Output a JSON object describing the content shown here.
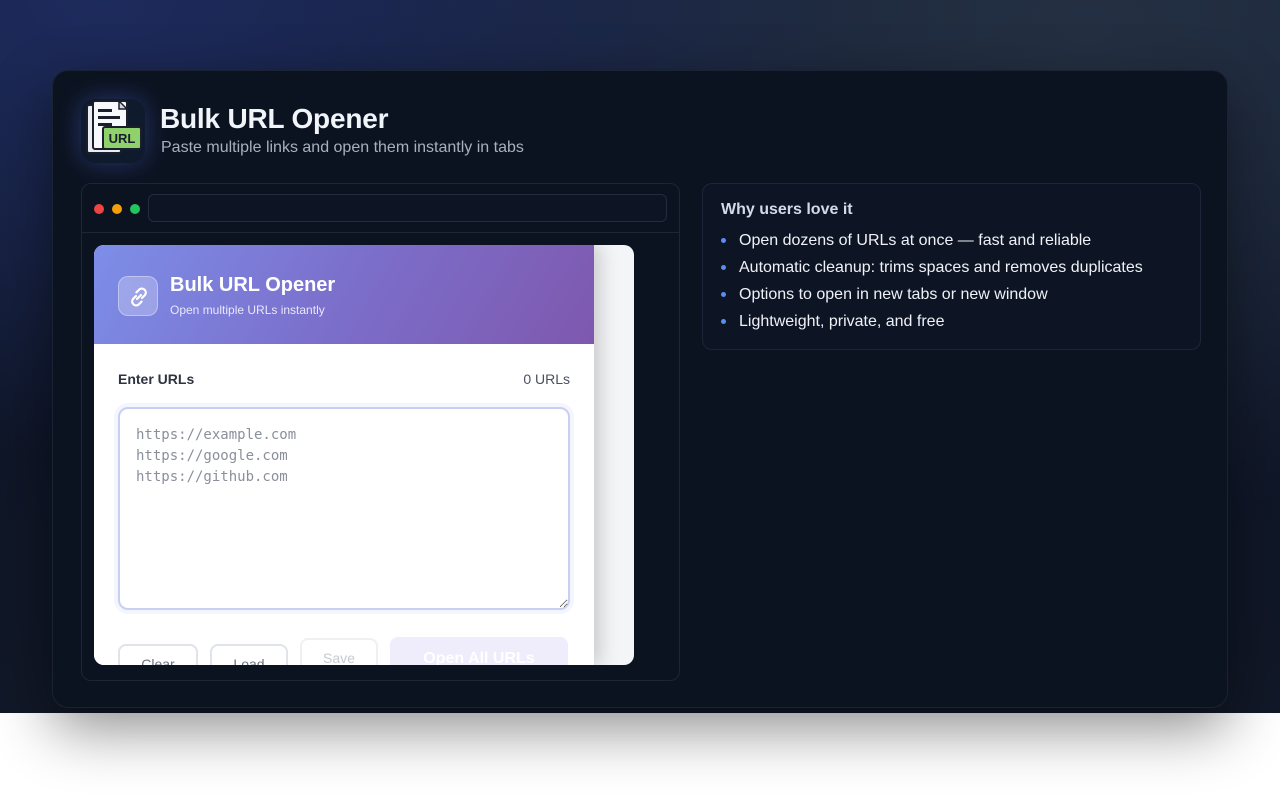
{
  "hero": {
    "title": "Bulk URL Opener",
    "subtitle": "Paste multiple links and open them instantly in tabs",
    "logo_badge": "URL"
  },
  "browser_mock": {
    "address_value": ""
  },
  "popup": {
    "title": "Bulk URL Opener",
    "subtitle": "Open multiple URLs instantly",
    "field_label": "Enter URLs",
    "url_count": "0 URLs",
    "textarea_placeholder": "https://example.com\nhttps://google.com\nhttps://github.com",
    "buttons": {
      "clear": "Clear",
      "load": "Load",
      "save": "Save",
      "open_all": "Open All URLs"
    }
  },
  "why": {
    "title": "Why users love it",
    "items": [
      "Open dozens of URLs at once — fast and reliable",
      "Automatic cleanup: trims spaces and removes duplicates",
      "Options to open in new tabs or new window",
      "Lightweight, private, and free"
    ]
  },
  "colors": {
    "accent": "#7b6fcb",
    "bullet": "#5b8cf0",
    "window_close": "#ef4444",
    "window_min": "#f59e0b",
    "window_max": "#22c55e"
  },
  "icons": {
    "logo": "document-url-icon",
    "popup": "link-icon"
  }
}
